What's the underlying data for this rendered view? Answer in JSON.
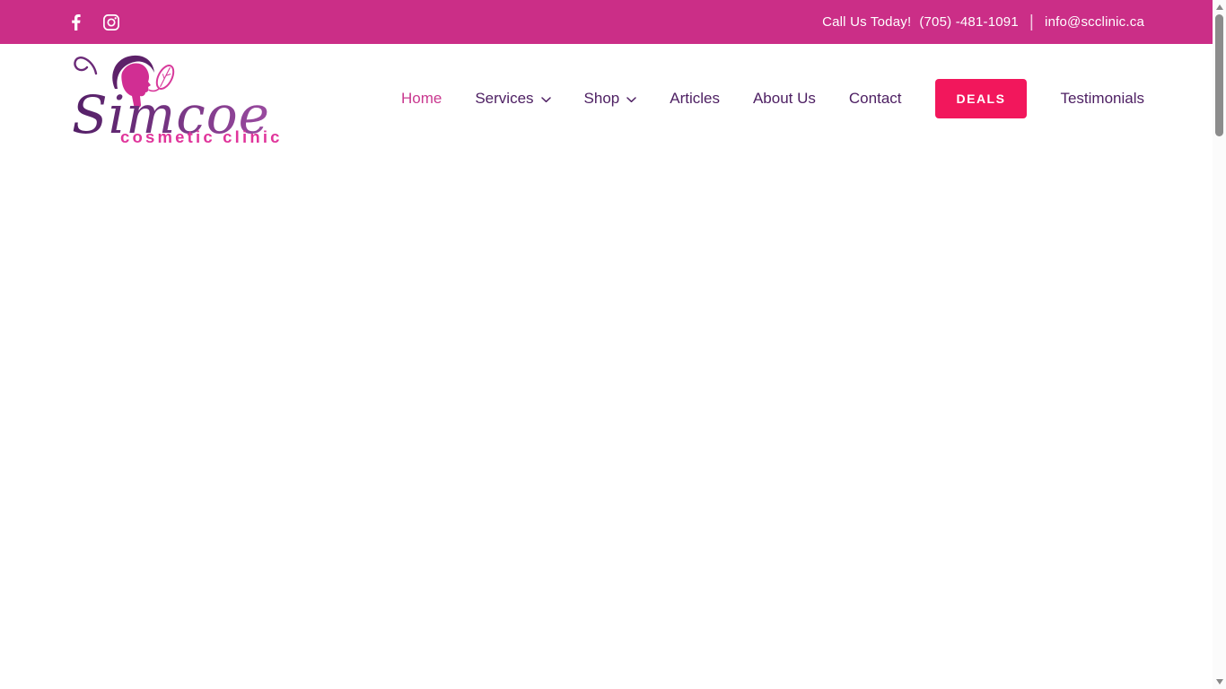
{
  "topbar": {
    "call_text": "Call Us Today!",
    "phone": "(705) -481-1091",
    "separator": "|",
    "email": "info@scclinic.ca",
    "bg_color": "#CB2E87",
    "social_icons": [
      "facebook-icon",
      "instagram-icon"
    ]
  },
  "logo": {
    "brand": "Simcoe",
    "tagline": "cosmetic clinic",
    "brand_color_dark": "#531F66",
    "brand_color_light": "#9A4BA0",
    "face_color": "#D12E93",
    "hair_color": "#5D2169",
    "tagline_color": "#E0359B"
  },
  "nav": {
    "items": [
      {
        "label": "Home",
        "active": true
      },
      {
        "label": "Services",
        "has_dropdown": true
      },
      {
        "label": "Shop",
        "has_dropdown": true
      },
      {
        "label": "Articles"
      },
      {
        "label": "About Us"
      },
      {
        "label": "Contact"
      },
      {
        "label": "DEALS",
        "type": "button"
      },
      {
        "label": "Testimonials"
      }
    ],
    "link_color": "#4E2063",
    "active_color": "#C9388F",
    "deals_bg_color": "#F2175C"
  },
  "scrollbar": {
    "thumb_color": "#8C8C8C",
    "icons": [
      "scroll-up-arrow-icon",
      "scroll-down-arrow-icon"
    ]
  }
}
